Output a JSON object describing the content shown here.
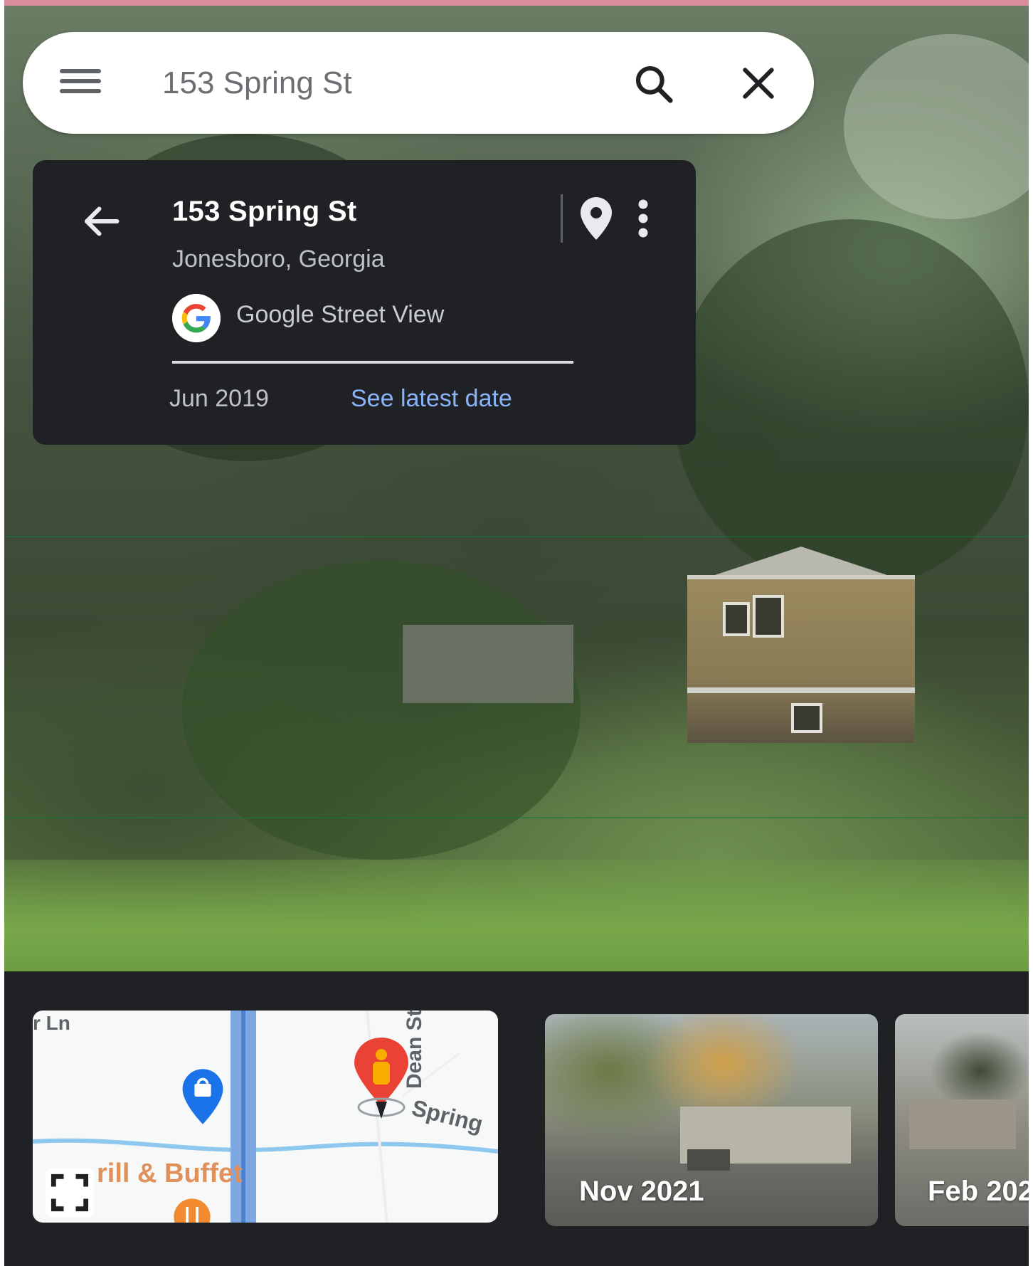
{
  "search": {
    "query": "153 Spring St"
  },
  "place": {
    "title": "153 Spring St",
    "subtitle": "Jonesboro, Georgia",
    "source": "Google Street View",
    "date": "Jun 2019",
    "latest_link": "See latest date"
  },
  "minimap": {
    "street_top_left": "r Ln",
    "street_right": "Dean St",
    "street_bottom": "Spring",
    "poi_label": "rill & Buffet"
  },
  "timeline": [
    {
      "label": "Nov 2021"
    },
    {
      "label": "Feb 202"
    }
  ],
  "colors": {
    "link": "#8ab4f8",
    "card_bg": "#202124",
    "pegman_red": "#ea4335",
    "pin_blue": "#1a73e8",
    "food_orange": "#f28b30"
  },
  "icons": {
    "menu": "menu-icon",
    "search": "search-icon",
    "close": "close-icon",
    "back": "arrow-left-icon",
    "pin": "map-pin-icon",
    "more": "more-vert-icon",
    "expand": "fullscreen-icon"
  }
}
